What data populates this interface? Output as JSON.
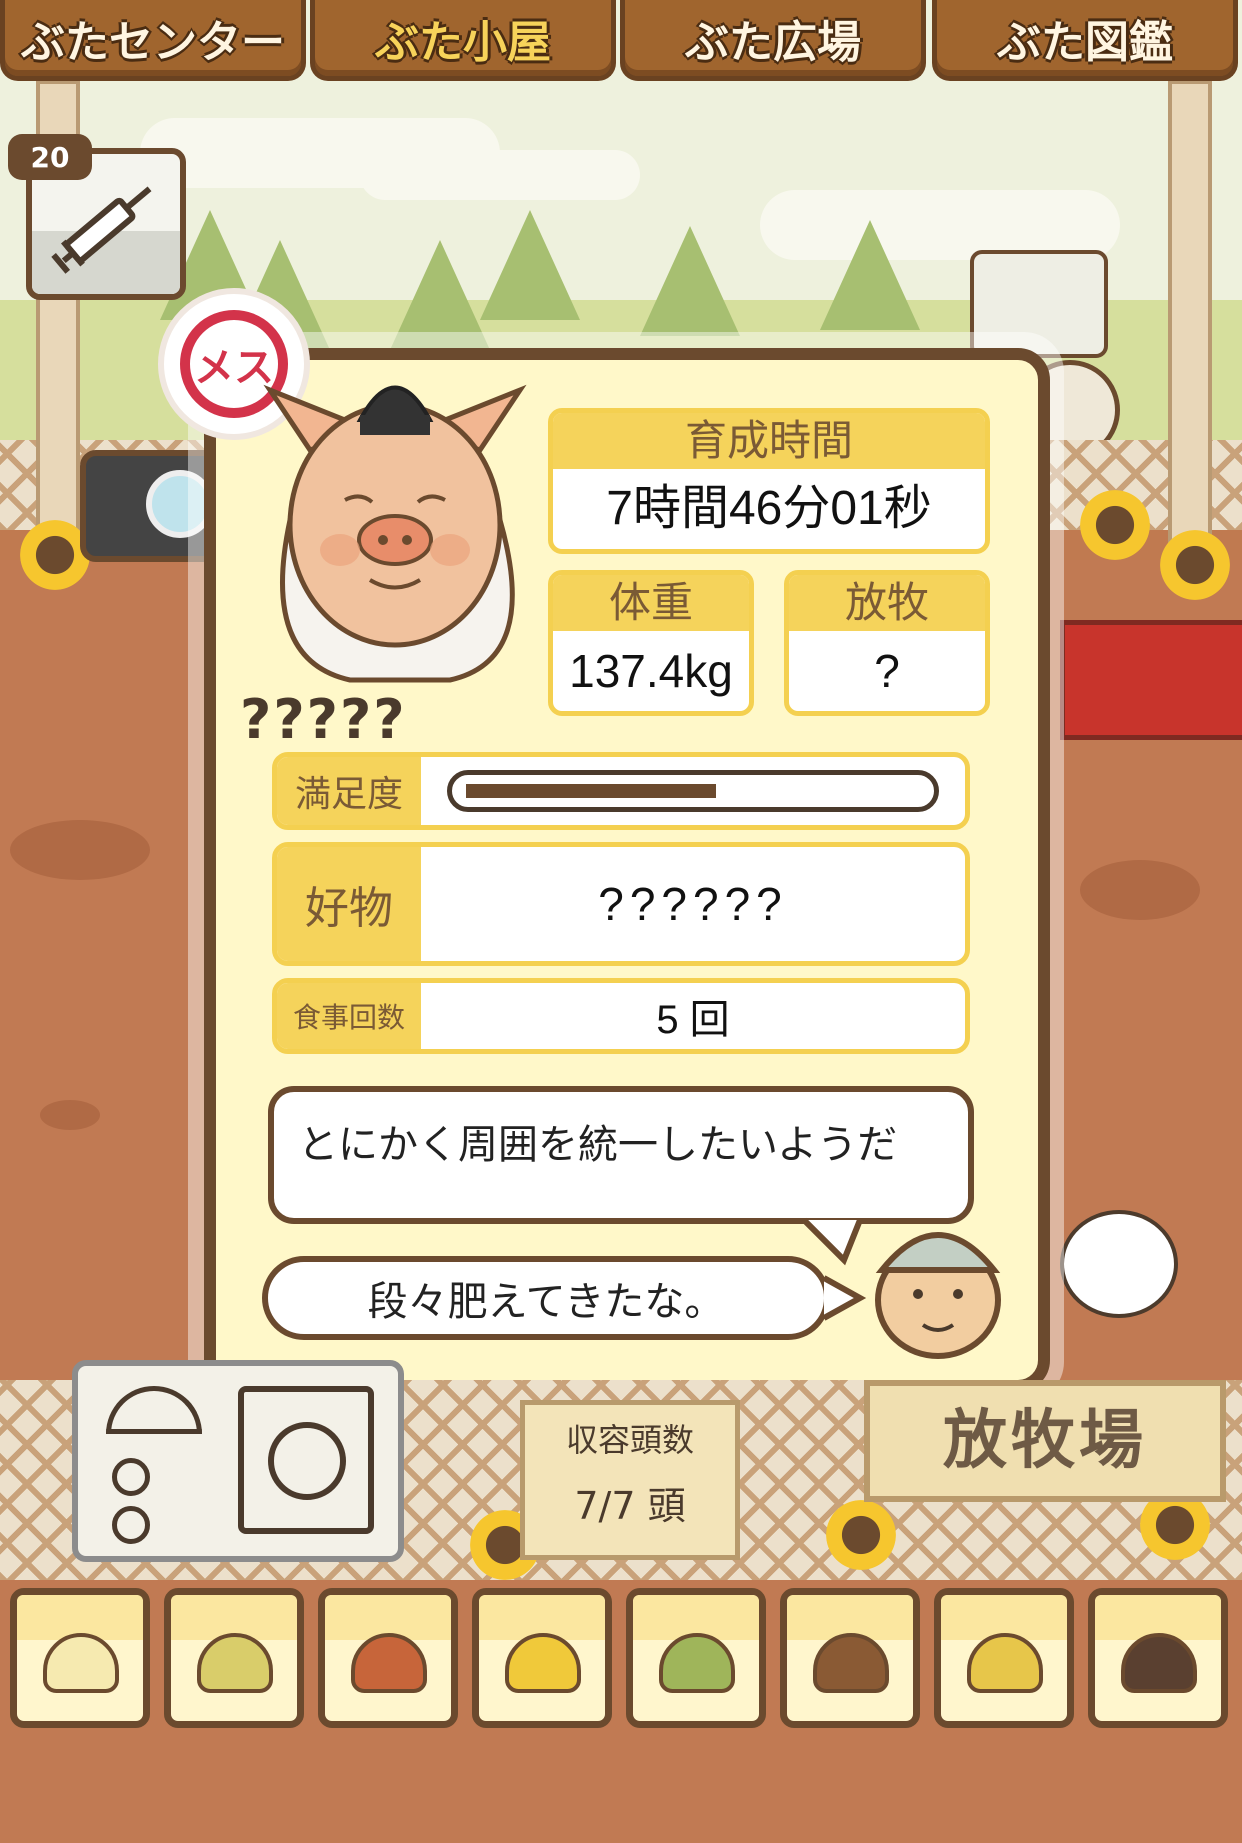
{
  "nav": {
    "tabs": [
      {
        "label": "ぶたセンター",
        "active": false
      },
      {
        "label": "ぶた小屋",
        "active": true
      },
      {
        "label": "ぶた広場",
        "active": false
      },
      {
        "label": "ぶた図鑑",
        "active": false
      }
    ]
  },
  "syringe": {
    "count": "20",
    "icon": "syringe-icon"
  },
  "pig": {
    "gender_label": "メス",
    "name": "?????",
    "growth_time_label": "育成時間",
    "growth_time_value": "7時間46分01秒",
    "weight_label": "体重",
    "weight_value": "137.4kg",
    "grazing_label": "放牧",
    "grazing_value": "?",
    "satisfaction_label": "満足度",
    "satisfaction_level": 0.55,
    "favorite_label": "好物",
    "favorite_value": "??????",
    "meals_label": "食事回数",
    "meals_value": "5 回",
    "description": "とにかく周囲を統一したいようだ",
    "farmer_comment": "段々肥えてきたな。"
  },
  "capacity": {
    "label": "収容頭数",
    "value": "7/7 頭"
  },
  "pasture_sign": {
    "label": "放牧場"
  },
  "foods": [
    {
      "name": "soybeans-icon"
    },
    {
      "name": "mixed-beans-icon"
    },
    {
      "name": "sweet-potato-icon"
    },
    {
      "name": "corn-icon"
    },
    {
      "name": "vegetables-icon"
    },
    {
      "name": "acorn-icon"
    },
    {
      "name": "grain-plate-icon"
    },
    {
      "name": "truffle-plate-icon"
    }
  ],
  "colors": {
    "accent": "#f5d35b",
    "frame": "#6b4a2e",
    "gender": "#d3334a"
  }
}
